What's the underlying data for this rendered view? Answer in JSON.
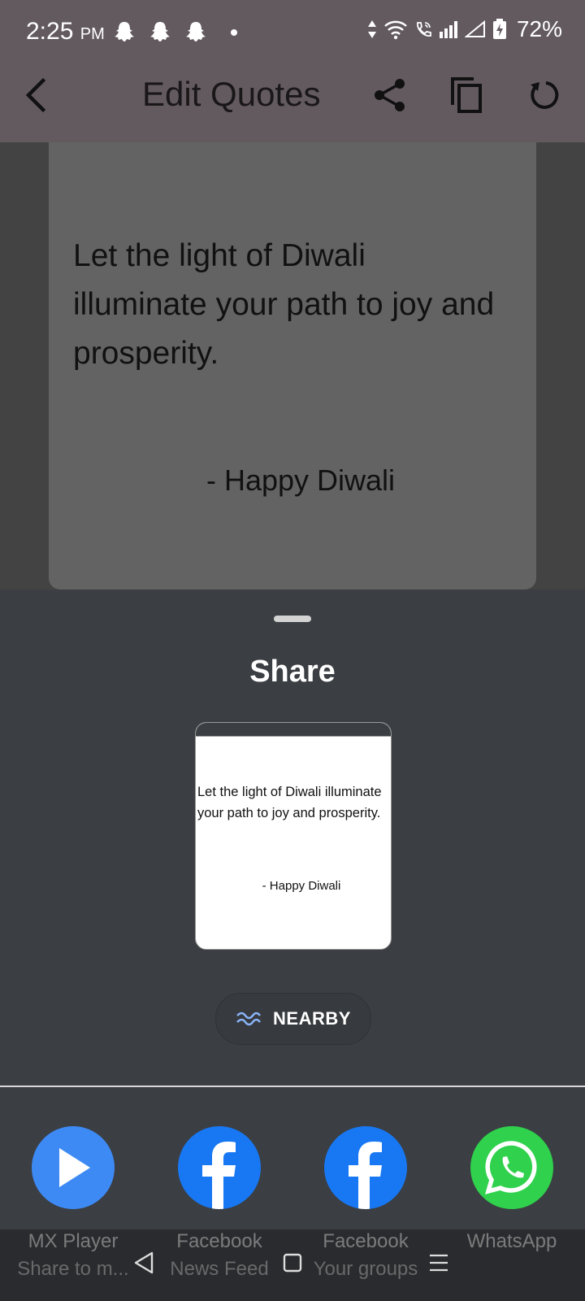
{
  "status_bar": {
    "time": "2:25",
    "ampm": "PM",
    "battery": "72%",
    "icons": [
      "snapchat-icon",
      "snapchat-icon",
      "snapchat-icon",
      "notification-dot",
      "data-arrows-icon",
      "wifi-icon",
      "wifi-calling-icon",
      "signal-icon",
      "signal-empty-icon",
      "battery-charging-icon"
    ]
  },
  "app_bar": {
    "title": "Edit Quotes",
    "back_icon": "back-arrow-icon",
    "share_icon": "share-icon",
    "copy_icon": "copy-icon",
    "refresh_icon": "refresh-icon"
  },
  "quote_card": {
    "text": "Let the light of Diwali illuminate your path to joy and prosperity.",
    "signature": "- Happy Diwali"
  },
  "share_sheet": {
    "title": "Share",
    "preview": {
      "text": "Let the light of Diwali illuminate your path to joy and prosperity.",
      "signature": "- Happy Diwali"
    },
    "nearby_label": "NEARBY",
    "apps": [
      {
        "name": "MX Player",
        "sub": "Share to m...",
        "icon": "mx-player-icon",
        "color": "#3d8af5"
      },
      {
        "name": "Facebook",
        "sub": "News Feed",
        "icon": "facebook-icon",
        "color": "#1877f2"
      },
      {
        "name": "Facebook",
        "sub": "Your groups",
        "icon": "facebook-icon",
        "color": "#1877f2"
      },
      {
        "name": "WhatsApp",
        "sub": "",
        "icon": "whatsapp-icon",
        "color": "#2fd14d"
      }
    ]
  },
  "nav_bar": {
    "buttons": [
      "back-triangle-icon",
      "home-square-icon",
      "recents-menu-icon"
    ]
  }
}
